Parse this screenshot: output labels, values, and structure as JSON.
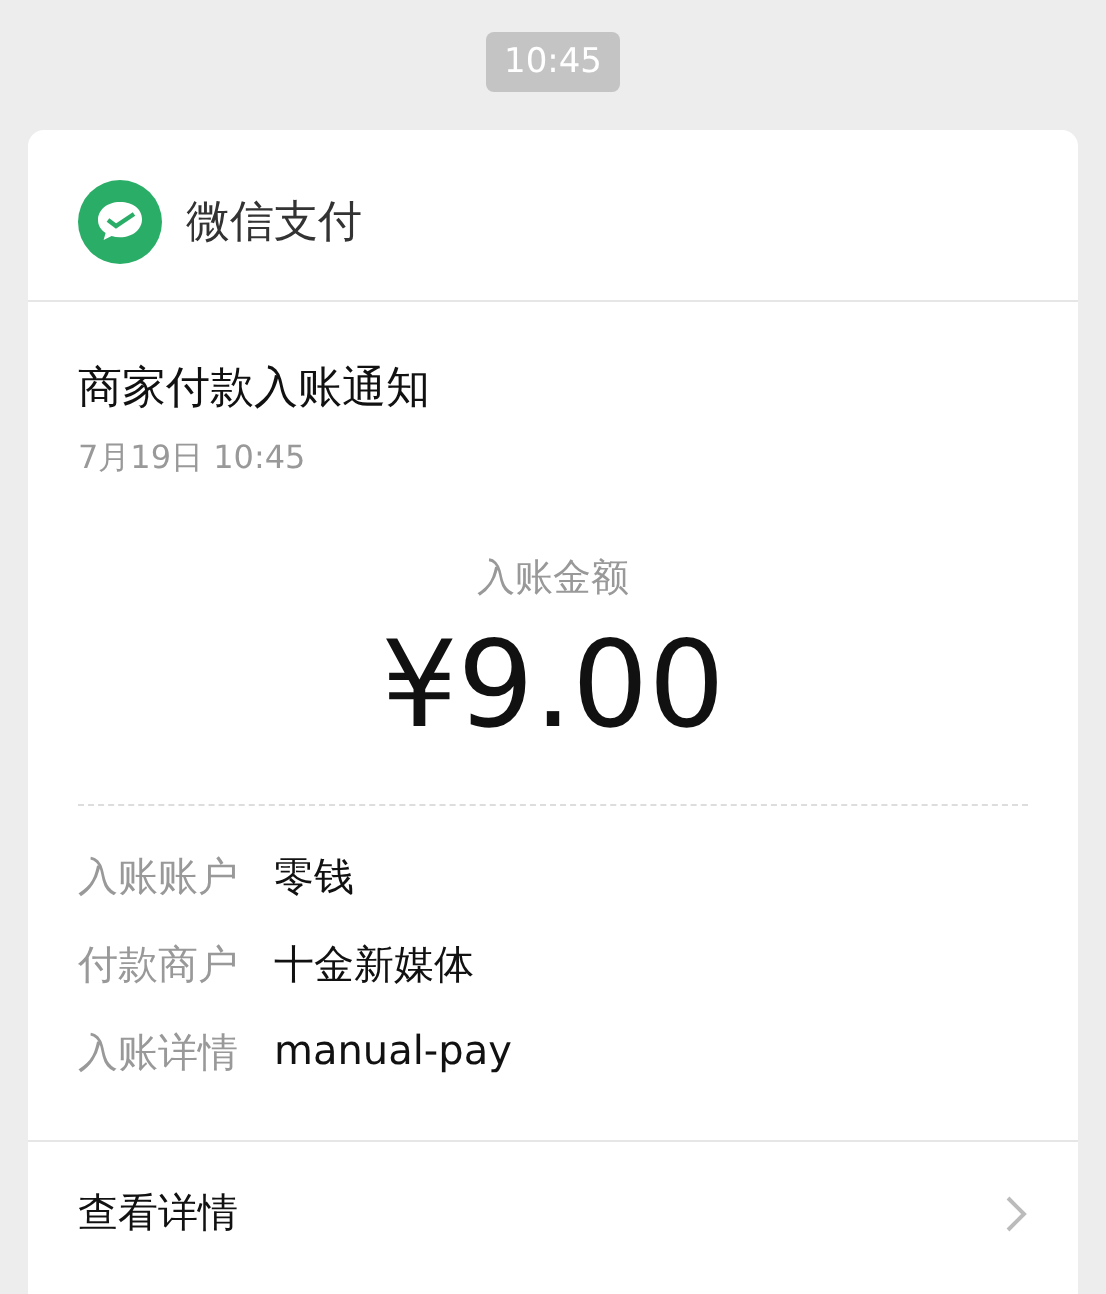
{
  "time": "10:45",
  "card": {
    "app_name": "微信支付",
    "title": "商家付款入账通知",
    "date": "7月19日  10:45",
    "amount_label": "入账金额",
    "amount": "¥9.00",
    "details": [
      {
        "label": "入账账户",
        "value": "零钱"
      },
      {
        "label": "付款商户",
        "value": "十金新媒体"
      },
      {
        "label": "入账详情",
        "value": "manual-pay"
      }
    ],
    "link": "查看详情"
  }
}
